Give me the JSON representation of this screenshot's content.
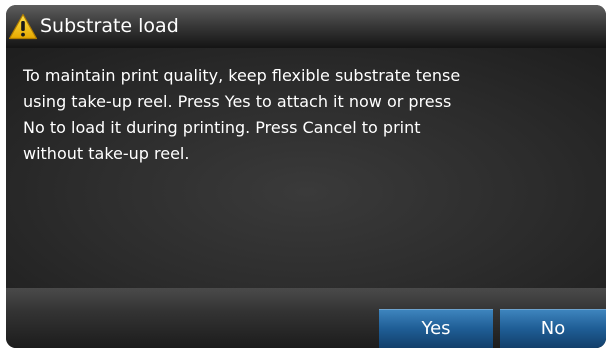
{
  "dialog": {
    "title": "Substrate load",
    "message": "To maintain print quality, keep flexible substrate tense\nusing take-up reel. Press Yes to attach it now or press\nNo to load it during printing. Press Cancel to print\nwithout take-up reel.",
    "title_icon": "warning-triangle-icon",
    "buttons": {
      "yes": "Yes",
      "no": "No"
    }
  },
  "colors": {
    "warning_icon": "#f5c400",
    "button": "#1f5e96",
    "background": "#2a2a2a",
    "text": "#ffffff"
  }
}
